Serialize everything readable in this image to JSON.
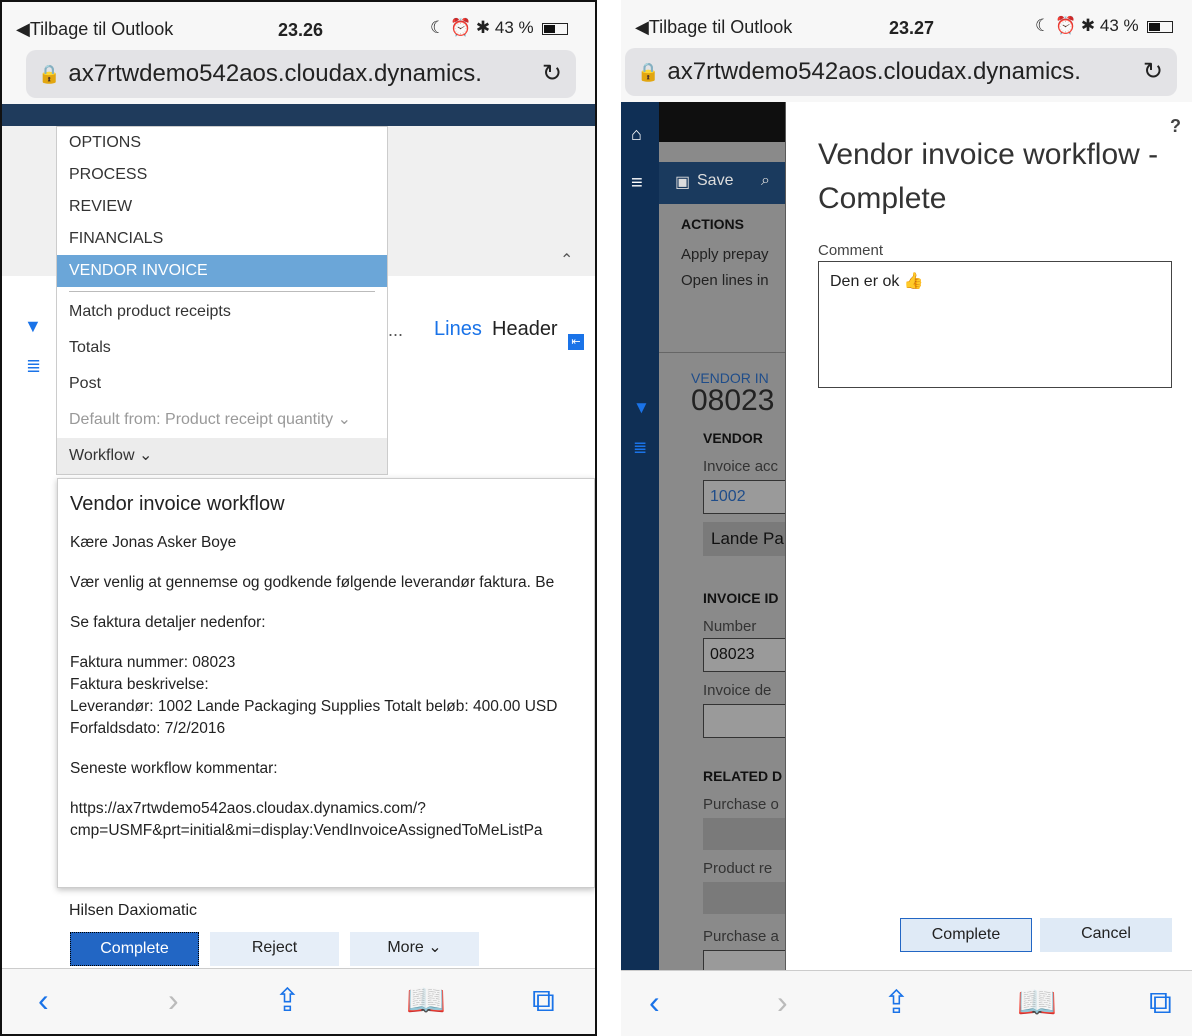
{
  "left": {
    "status": {
      "back": "◀Tilbage til Outlook",
      "time": "23.26",
      "battery": "43 %"
    },
    "url": "ax7rtwdemo542aos.cloudax.dynamics.",
    "menu": {
      "tabs": [
        "OPTIONS",
        "PROCESS",
        "REVIEW",
        "FINANCIALS",
        "VENDOR INVOICE"
      ],
      "items": [
        "Match product receipts",
        "Totals",
        "Post",
        "Default from: Product receipt quantity ⌄",
        "Workflow ⌄"
      ]
    },
    "behind": {
      "ellipsis": "...",
      "lines": "Lines",
      "header": "Header"
    },
    "workflow_box": {
      "title": "Vendor invoice workflow",
      "greeting": "Kære Jonas Asker Boye",
      "intro": "Vær venlig at gennemse og godkende følgende leverandør faktura. Be",
      "details_heading": "Se faktura detaljer nedenfor:",
      "invoice_number": "Faktura nummer: 08023",
      "invoice_desc": "Faktura beskrivelse:",
      "vendor_line": "Leverandør: 1002 Lande Packaging Supplies Totalt beløb: 400.00 USD",
      "due_date": "Forfaldsdato: 7/2/2016",
      "last_comment": "Seneste workflow kommentar:",
      "link1": "https://ax7rtwdemo542aos.cloudax.dynamics.com/?",
      "link2": "cmp=USMF&prt=initial&mi=display:VendInvoiceAssignedToMeListPa"
    },
    "signature": "Hilsen Daxiomatic",
    "buttons": {
      "complete": "Complete",
      "reject": "Reject",
      "more": "More ⌄"
    }
  },
  "right": {
    "status": {
      "back": "◀Tilbage til Outlook",
      "time": "23.27",
      "battery": "43 %"
    },
    "url": "ax7rtwdemo542aos.cloudax.dynamics.",
    "toolbar": {
      "save": "Save"
    },
    "actions": {
      "heading": "ACTIONS",
      "apply": "Apply prepay",
      "open": "Open lines in"
    },
    "form": {
      "vendor_inv": "VENDOR IN",
      "invoice_no": "08023",
      "vendor_heading": "VENDOR",
      "invoice_acc_label": "Invoice acc",
      "invoice_acc_value": "1002",
      "vendor_name": "Lande Pa",
      "invoice_id_heading": "INVOICE ID",
      "number_label": "Number",
      "number_value": "08023",
      "invoice_desc_label": "Invoice de",
      "related_heading": "RELATED D",
      "purchase_label": "Purchase o",
      "product_label": "Product re",
      "purchase_a_label": "Purchase a"
    },
    "dialog": {
      "help": "?",
      "title1": "Vendor invoice workflow -",
      "title2": "Complete",
      "comment_label": "Comment",
      "comment_value": "Den er ok 👍",
      "complete": "Complete",
      "cancel": "Cancel"
    }
  }
}
